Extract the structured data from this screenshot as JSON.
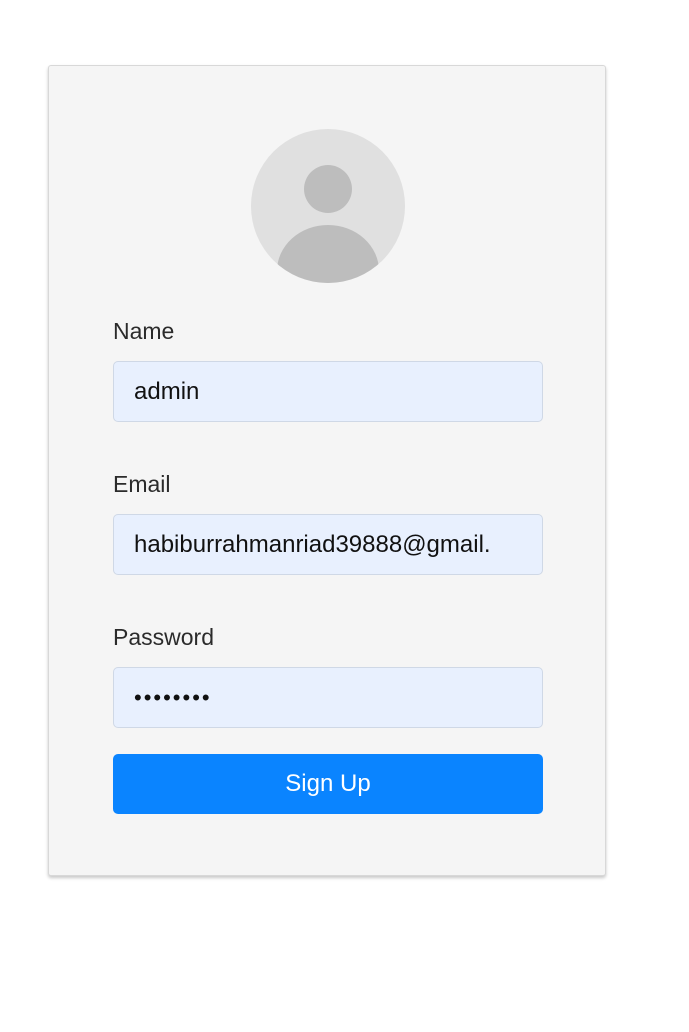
{
  "avatar": {
    "icon": "user-avatar-icon",
    "background": "#e0e0e0",
    "figure_color": "#bdbdbd"
  },
  "form": {
    "name": {
      "label": "Name",
      "value": "admin"
    },
    "email": {
      "label": "Email",
      "value": "habiburrahmanriad39888@gmail."
    },
    "password": {
      "label": "Password",
      "value": "••••••••"
    },
    "submit_label": "Sign Up"
  },
  "colors": {
    "card_background": "#f5f5f5",
    "input_background": "#e8f0fe",
    "button_background": "#0a84ff",
    "button_text": "#ffffff"
  }
}
